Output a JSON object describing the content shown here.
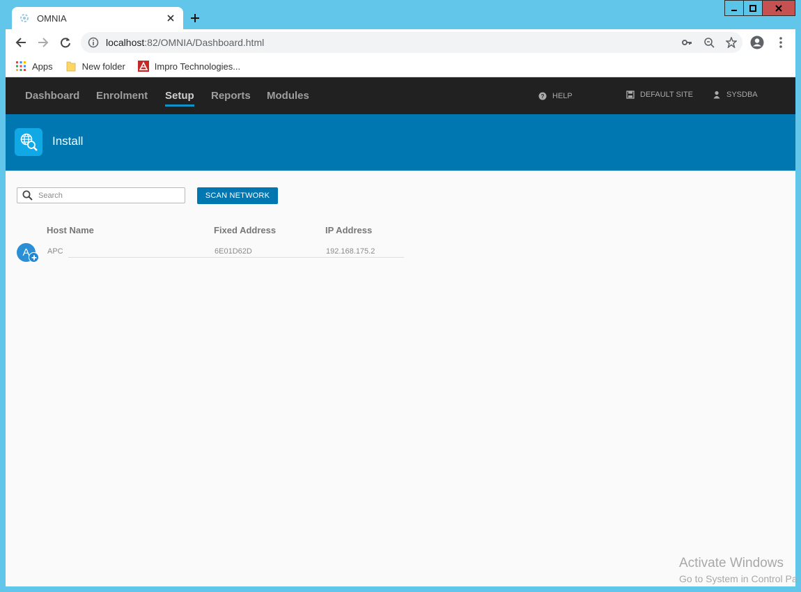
{
  "window": {
    "controls": [
      "minimize-icon",
      "maximize-icon",
      "close-icon"
    ]
  },
  "browser": {
    "tab_title": "OMNIA",
    "url_host": "localhost",
    "url_rest": ":82/OMNIA/Dashboard.html",
    "bookmarks": [
      {
        "label": "Apps",
        "icon": "apps-grid-icon"
      },
      {
        "label": "New folder",
        "icon": "folder-icon"
      },
      {
        "label": "Impro Technologies...",
        "icon": "impro-logo-icon"
      }
    ]
  },
  "nav": {
    "links": [
      "Dashboard",
      "Enrolment",
      "Setup",
      "Reports",
      "Modules"
    ],
    "active": "Setup",
    "help": "HELP",
    "site": "DEFAULT SITE",
    "user": "SYSDBA"
  },
  "page": {
    "title": "Install",
    "search_placeholder": "Search",
    "scan_button": "SCAN NETWORK"
  },
  "table": {
    "headers": [
      "Host Name",
      "Fixed Address",
      "IP Address"
    ],
    "rows": [
      {
        "avatar": "A",
        "host": "APC",
        "fixed": "6E01D62D",
        "ip": "192.168.175.2"
      }
    ]
  },
  "watermark": {
    "line1": "Activate Windows",
    "line2": "Go to System in Control Pa"
  },
  "colors": {
    "nav_bg": "#212121",
    "band": "#0077b0",
    "accent": "#0e94c9",
    "frame": "#62c6ea"
  }
}
